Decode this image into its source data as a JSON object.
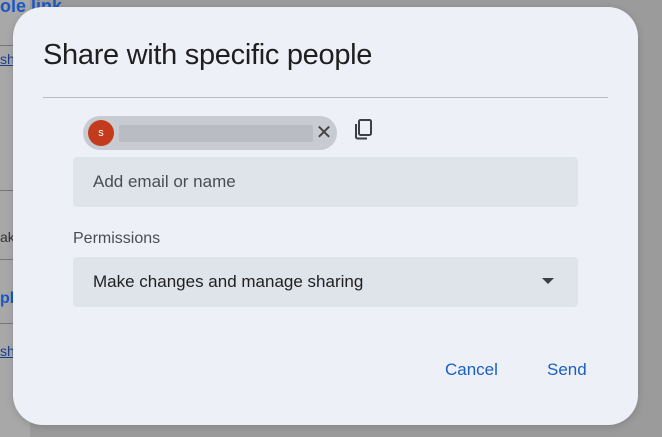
{
  "background": {
    "title_fragment": "ole link",
    "fragments": [
      "sh",
      "ak",
      "pl",
      "sh"
    ]
  },
  "dialog": {
    "title": "Share with specific people",
    "recipient_chip": {
      "avatar_initial": "s",
      "avatar_color": "#c33b1c"
    },
    "input": {
      "placeholder": "Add email or name"
    },
    "permissions": {
      "label": "Permissions",
      "selected": "Make changes and manage sharing"
    },
    "buttons": {
      "cancel": "Cancel",
      "send": "Send"
    }
  },
  "colors": {
    "accent": "#1a5fc2",
    "dialog_bg": "#eef0f7",
    "field_bg": "#dfe3ea"
  }
}
